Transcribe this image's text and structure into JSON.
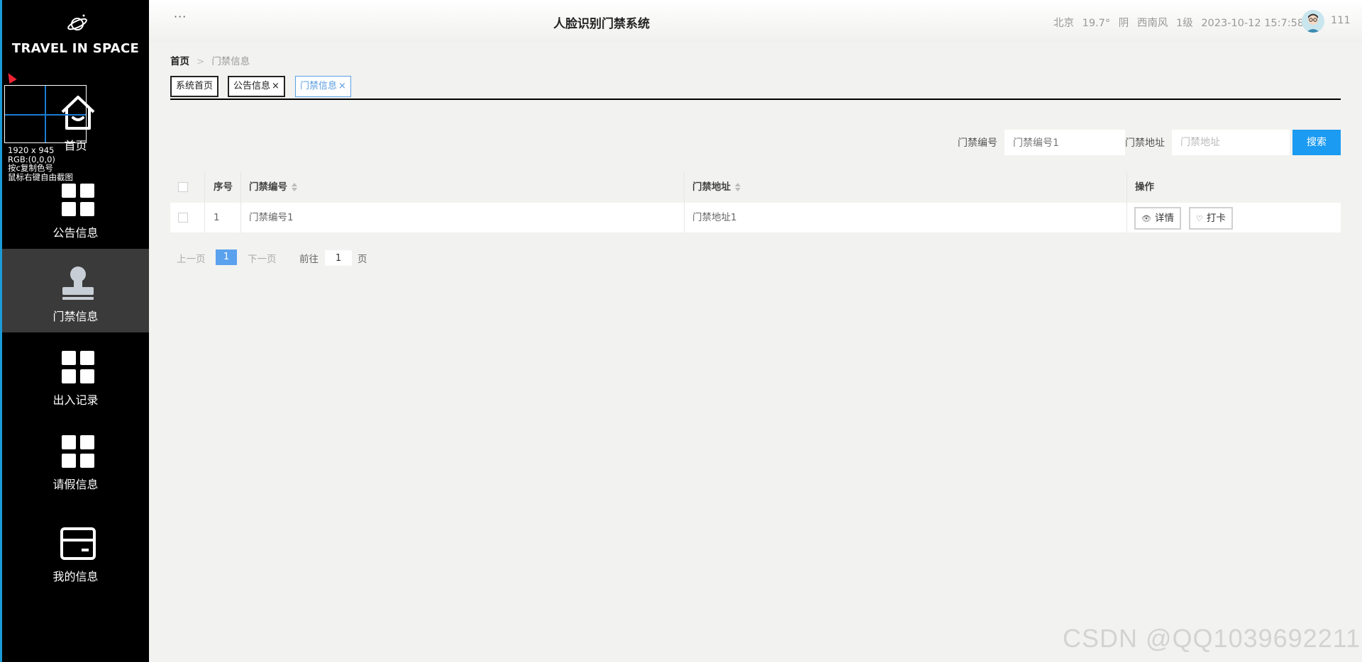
{
  "brand": {
    "title": "TRAVEL IN SPACE",
    "logo_icon": "planet-icon"
  },
  "sidebar": {
    "items": [
      {
        "label": "首页",
        "icon": "home-icon"
      },
      {
        "label": "公告信息",
        "icon": "grid-icon"
      },
      {
        "label": "门禁信息",
        "icon": "stamp-icon",
        "active": true
      },
      {
        "label": "出入记录",
        "icon": "grid-icon"
      },
      {
        "label": "请假信息",
        "icon": "grid-icon"
      },
      {
        "label": "我的信息",
        "icon": "card-icon"
      }
    ]
  },
  "ruler_overlay": {
    "lines": [
      "1920 x 945",
      "RGB:(0,0,0)",
      "按c复制色号",
      "鼠标右键自由截图"
    ]
  },
  "header": {
    "more": "···",
    "title": "人脸识别门禁系统",
    "weather": {
      "city": "北京",
      "temp": "19.7°",
      "condition": "阴",
      "wind": "西南风",
      "level": "1级",
      "datetime": "2023-10-12 15:7:58"
    },
    "username": "111"
  },
  "breadcrumb": {
    "home": "首页",
    "separator": ">",
    "current": "门禁信息"
  },
  "tabs": [
    {
      "label": "系统首页",
      "closable": false
    },
    {
      "label": "公告信息",
      "closable": true
    },
    {
      "label": "门禁信息",
      "closable": true,
      "active": true
    }
  ],
  "tab_close_glyph": "×",
  "search": {
    "field1_label": "门禁编号",
    "field1_value": "门禁编号1",
    "field2_label": "门禁地址",
    "field2_placeholder": "门禁地址",
    "button": "搜索"
  },
  "table": {
    "columns": [
      "序号",
      "门禁编号",
      "门禁地址",
      "操作"
    ],
    "rows": [
      {
        "index": "1",
        "code": "门禁编号1",
        "address": "门禁地址1"
      }
    ],
    "actions": {
      "detail": "详情",
      "checkin": "打卡"
    }
  },
  "pagination": {
    "prev": "上一页",
    "current": "1",
    "next": "下一页",
    "goto_label": "前往",
    "goto_value": "1",
    "page_unit": "页"
  },
  "watermark": "CSDN @QQ1039692211",
  "colors": {
    "accent": "#1b9bf2",
    "sidebar_bg": "#000000",
    "sidebar_active": "#3a3a3a",
    "page_bg": "#f2f2f0",
    "active_tab": "#5a9de0"
  }
}
